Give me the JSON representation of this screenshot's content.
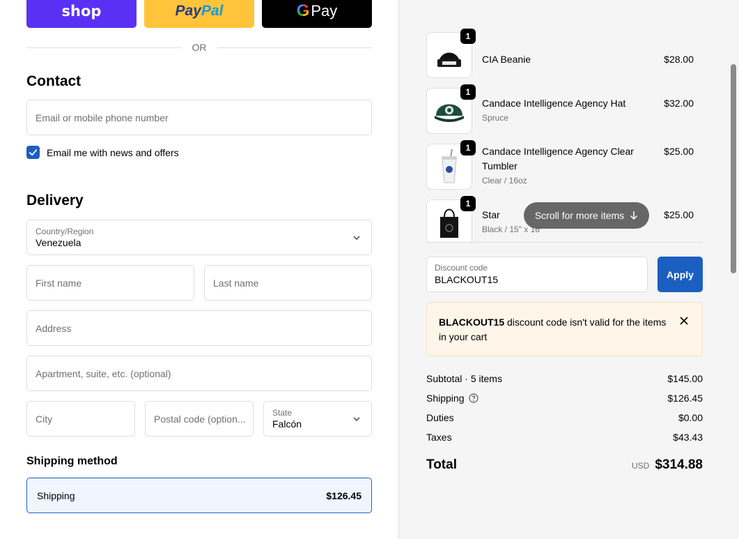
{
  "express": {
    "shop_label": "shop",
    "paypal_label_1": "Pay",
    "paypal_label_2": "Pal",
    "gpay_g": "G",
    "gpay_label": "Pay",
    "or_label": "OR"
  },
  "contact": {
    "title": "Contact",
    "email_placeholder": "Email or mobile phone number",
    "newsletter_label": "Email me with news and offers",
    "newsletter_checked": true
  },
  "delivery": {
    "title": "Delivery",
    "country_label": "Country/Region",
    "country_value": "Venezuela",
    "first_name_placeholder": "First name",
    "last_name_placeholder": "Last name",
    "address_placeholder": "Address",
    "apartment_placeholder": "Apartment, suite, etc. (optional)",
    "city_placeholder": "City",
    "postal_placeholder": "Postal code (option...",
    "state_label": "State",
    "state_value": "Falcón"
  },
  "shipping_method": {
    "title": "Shipping method",
    "option_label": "Shipping",
    "option_price": "$126.45"
  },
  "cart": {
    "items": [
      {
        "name": "CIA Beanie",
        "variant": "",
        "price": "$28.00",
        "qty": "1",
        "icon": "beanie-icon"
      },
      {
        "name": "Candace Intelligence Agency Hat",
        "variant": "Spruce",
        "price": "$32.00",
        "qty": "1",
        "icon": "hat-icon"
      },
      {
        "name": "Candace Intelligence Agency Clear Tumbler",
        "variant": "Clear / 16oz",
        "price": "$25.00",
        "qty": "1",
        "icon": "tumbler-icon"
      },
      {
        "name": "Star",
        "variant": "Black / 15\" x 16\"",
        "price": "$25.00",
        "qty": "1",
        "icon": "tote-bag-icon"
      }
    ],
    "scroll_hint": "Scroll for more items"
  },
  "discount": {
    "label": "Discount code",
    "value": "BLACKOUT15",
    "apply_label": "Apply",
    "notice_code": "BLACKOUT15",
    "notice_text": " discount code isn't valid for the items in your cart"
  },
  "summary": {
    "subtotal_label": "Subtotal · 5 items",
    "subtotal_value": "$145.00",
    "shipping_label": "Shipping",
    "shipping_value": "$126.45",
    "duties_label": "Duties",
    "duties_value": "$0.00",
    "taxes_label": "Taxes",
    "taxes_value": "$43.43",
    "total_label": "Total",
    "total_currency": "USD",
    "total_value": "$314.88"
  },
  "colors": {
    "accent": "#1b5fc1",
    "shop": "#5a31f4",
    "paypal": "#ffc439",
    "notice_bg": "#fff5e9"
  }
}
